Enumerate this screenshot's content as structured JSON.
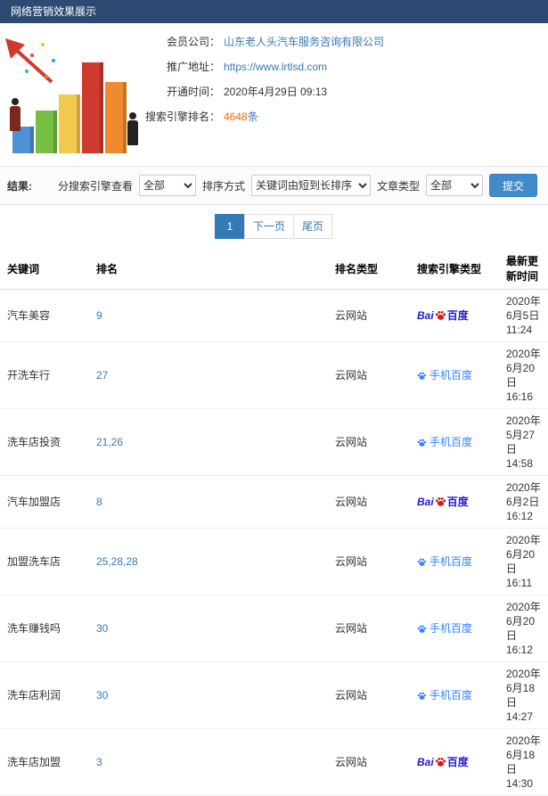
{
  "header": {
    "title": "网络营销效果展示"
  },
  "info": {
    "company_label": "会员公司：",
    "company_value": "山东老人头汽车服务咨询有限公司",
    "url_label": "推广地址：",
    "url_value": "https://www.lrtlsd.com",
    "opened_label": "开通时间：",
    "opened_value": "2020年4月29日 09:13",
    "rank_label": "搜索引擎排名：",
    "rank_count": "4648",
    "rank_unit": "条"
  },
  "filters": {
    "section_title": "结果:",
    "engine_filter_label": "分搜索引擎查看",
    "engine_filter_value": "全部",
    "sort_label": "排序方式",
    "sort_value": "关键词由短到长排序",
    "type_label": "文章类型",
    "type_value": "全部",
    "submit_label": "提交"
  },
  "pagination": {
    "current": "1",
    "next": "下一页",
    "last": "尾页"
  },
  "table": {
    "headers": [
      "关键词",
      "排名",
      "排名类型",
      "搜索引擎类型",
      "最新更新时间"
    ],
    "engines": {
      "baidu": {
        "prefix": "Bai",
        "suffix": "百度"
      },
      "mobile": {
        "label": "手机百度"
      }
    },
    "rows": [
      {
        "keyword": "汽车美容",
        "rank": "9",
        "rank_type": "云网站",
        "engine": "baidu",
        "updated": "2020年6月5日 11:24"
      },
      {
        "keyword": "开洗车行",
        "rank": "27",
        "rank_type": "云网站",
        "engine": "mobile",
        "updated": "2020年6月20日 16:16"
      },
      {
        "keyword": "洗车店投资",
        "rank": "21,26",
        "rank_type": "云网站",
        "engine": "mobile",
        "updated": "2020年5月27日 14:58"
      },
      {
        "keyword": "汽车加盟店",
        "rank": "8",
        "rank_type": "云网站",
        "engine": "baidu",
        "updated": "2020年6月2日 16:12"
      },
      {
        "keyword": "加盟洗车店",
        "rank": "25,28,28",
        "rank_type": "云网站",
        "engine": "mobile",
        "updated": "2020年6月20日 16:11"
      },
      {
        "keyword": "洗车赚钱吗",
        "rank": "30",
        "rank_type": "云网站",
        "engine": "mobile",
        "updated": "2020年6月20日 16:12"
      },
      {
        "keyword": "洗车店利润",
        "rank": "30",
        "rank_type": "云网站",
        "engine": "mobile",
        "updated": "2020年6月18日 14:27"
      },
      {
        "keyword": "洗车店加盟",
        "rank": "3",
        "rank_type": "云网站",
        "engine": "baidu",
        "updated": "2020年6月18日 14:30"
      }
    ]
  },
  "colors": {
    "header_bar": "#2e4a73",
    "accent_blue": "#337ab7",
    "rank_count_orange": "#ff6600",
    "baidu_blue": "#2319dc",
    "baidu_paw_red": "#e0151c",
    "mobile_baidu_blue": "#3385ff"
  }
}
